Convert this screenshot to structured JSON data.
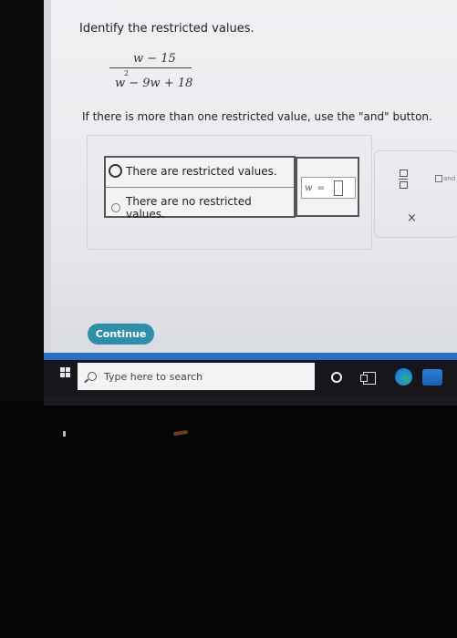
{
  "question": {
    "prompt": "Identify the restricted values.",
    "numerator": "w − 15",
    "denominator": "w  − 9w + 18",
    "exponent": "2",
    "instruction": "If there is more than one restricted value, use the \"and\" button."
  },
  "choices": [
    {
      "label": "There are restricted values.",
      "selected": true
    },
    {
      "label": "There are no restricted values.",
      "selected": false
    }
  ],
  "answer_input": {
    "variable": "w",
    "equals": "="
  },
  "tools": {
    "and_label": "and",
    "clear_symbol": "×"
  },
  "continue_label": "Continue",
  "taskbar": {
    "search_placeholder": "Type here to search"
  },
  "colors": {
    "continue": "#2f8fa8",
    "taskbar": "#15151a",
    "accent_band": "#2a6fc2"
  }
}
